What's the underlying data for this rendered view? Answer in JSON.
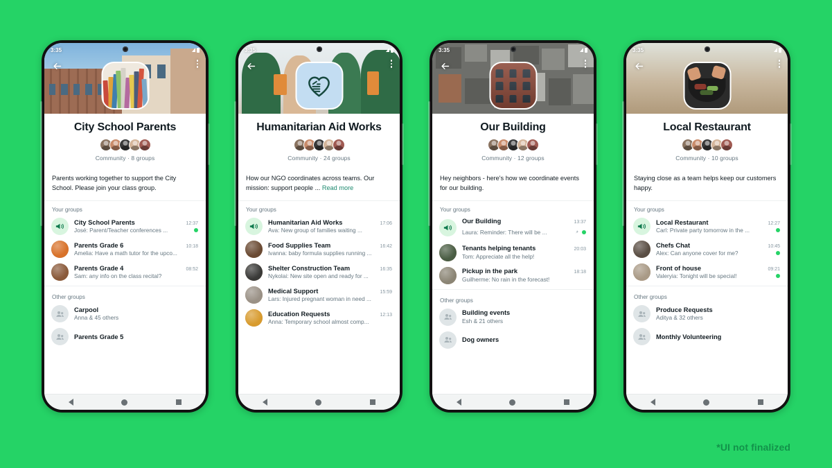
{
  "page": {
    "background_color": "#25d366",
    "footnote": "*UI not finalized",
    "footnote_color": "#12924a"
  },
  "status_bar": {
    "time": "3:35"
  },
  "nav_bar": {
    "back_label": "back",
    "home_label": "home",
    "recents_label": "recents"
  },
  "labels": {
    "your_groups": "Your groups",
    "other_groups": "Other groups",
    "read_more": "Read more"
  },
  "phones": [
    {
      "id": "city-school-parents",
      "cover": "school-building-photo",
      "tile_icon": "books-photo",
      "title": "City School Parents",
      "subtitle": "Community · 8 groups",
      "description": "Parents working together to support the City School. Please join your class group.",
      "read_more": false,
      "your_groups": [
        {
          "avatar": "announcement-megaphone",
          "name": "City School Parents",
          "time": "12:37",
          "snippet": "José: Parent/Teacher conferences ...",
          "unread": true,
          "pinned": false
        },
        {
          "avatar": "photo-autumn",
          "name": "Parents Grade 6",
          "time": "10:18",
          "snippet": "Amelia: Have a math tutor for the upco...",
          "unread": false,
          "pinned": false
        },
        {
          "avatar": "photo-party",
          "name": "Parents Grade 4",
          "time": "08:52",
          "snippet": "Sam: any info on the class recital?",
          "unread": false,
          "pinned": false
        }
      ],
      "other_groups": [
        {
          "avatar": "group-placeholder",
          "name": "Carpool",
          "members": "Anna & 45 others"
        },
        {
          "avatar": "group-placeholder",
          "name": "Parents Grade 5",
          "members": ""
        }
      ]
    },
    {
      "id": "humanitarian-aid-works",
      "cover": "volunteers-photo",
      "tile_icon": "heart-hand-logo",
      "title": "Humanitarian Aid Works",
      "subtitle": "Community · 24 groups",
      "description": "How our NGO coordinates across teams. Our mission: support people ...",
      "read_more": true,
      "your_groups": [
        {
          "avatar": "announcement-megaphone",
          "name": "Humanitarian Aid Works",
          "time": "17:06",
          "snippet": "Ava: New group of families waiting ...",
          "unread": false,
          "pinned": false
        },
        {
          "avatar": "photo-supplies",
          "name": "Food Supplies Team",
          "time": "16:42",
          "snippet": "Ivanna: baby formula supplies running ...",
          "unread": false,
          "pinned": false
        },
        {
          "avatar": "photo-construction",
          "name": "Shelter Construction Team",
          "time": "16:35",
          "snippet": "Nykolai: New site open and ready for ...",
          "unread": false,
          "pinned": false
        },
        {
          "avatar": "photo-medical",
          "name": "Medical Support",
          "time": "15:59",
          "snippet": "Lars: Injured pregnant woman in need ...",
          "unread": false,
          "pinned": false
        },
        {
          "avatar": "photo-education",
          "name": "Education Requests",
          "time": "12:13",
          "snippet": "Anna: Temporary school almost comp...",
          "unread": false,
          "pinned": false
        }
      ],
      "other_groups": []
    },
    {
      "id": "our-building",
      "cover": "city-aerial-photo",
      "tile_icon": "brick-building-photo",
      "title": "Our Building",
      "subtitle": "Community · 12 groups",
      "description": "Hey neighbors - here's how we coordinate events for our building.",
      "read_more": false,
      "your_groups": [
        {
          "avatar": "announcement-megaphone",
          "name": "Our Building",
          "time": "13:37",
          "snippet": "Laura: Reminder:  There will be ...",
          "unread": true,
          "pinned": true
        },
        {
          "avatar": "photo-tenants",
          "name": "Tenants helping tenants",
          "time": "20:03",
          "snippet": "Tom: Appreciate all the help!",
          "unread": false,
          "pinned": false
        },
        {
          "avatar": "photo-park",
          "name": "Pickup in the park",
          "time": "18:18",
          "snippet": "Guilherme: No rain in the forecast!",
          "unread": false,
          "pinned": false
        }
      ],
      "other_groups": [
        {
          "avatar": "group-placeholder",
          "name": "Building events",
          "members": "Esh & 21 others"
        },
        {
          "avatar": "group-placeholder",
          "name": "Dog owners",
          "members": ""
        }
      ]
    },
    {
      "id": "local-restaurant",
      "cover": "restaurant-tables-photo",
      "tile_icon": "food-plate-photo",
      "title": "Local Restaurant",
      "subtitle": "Community · 10 groups",
      "description": "Staying close as a team helps keep our customers happy.",
      "read_more": false,
      "your_groups": [
        {
          "avatar": "announcement-megaphone",
          "name": "Local Restaurant",
          "time": "12:27",
          "snippet": "Carl: Private party tomorrow in the ...",
          "unread": true,
          "pinned": false
        },
        {
          "avatar": "photo-chefs",
          "name": "Chefs Chat",
          "time": "10:45",
          "snippet": "Alex: Can anyone cover for me?",
          "unread": true,
          "pinned": false
        },
        {
          "avatar": "photo-house",
          "name": "Front of house",
          "time": "09:21",
          "snippet": "Valeryia: Tonight will be special!",
          "unread": true,
          "pinned": false
        }
      ],
      "other_groups": [
        {
          "avatar": "group-placeholder",
          "name": "Produce Requests",
          "members": "Aditya & 32 others"
        },
        {
          "avatar": "group-placeholder",
          "name": "Monthly Volunteering",
          "members": ""
        }
      ]
    }
  ]
}
